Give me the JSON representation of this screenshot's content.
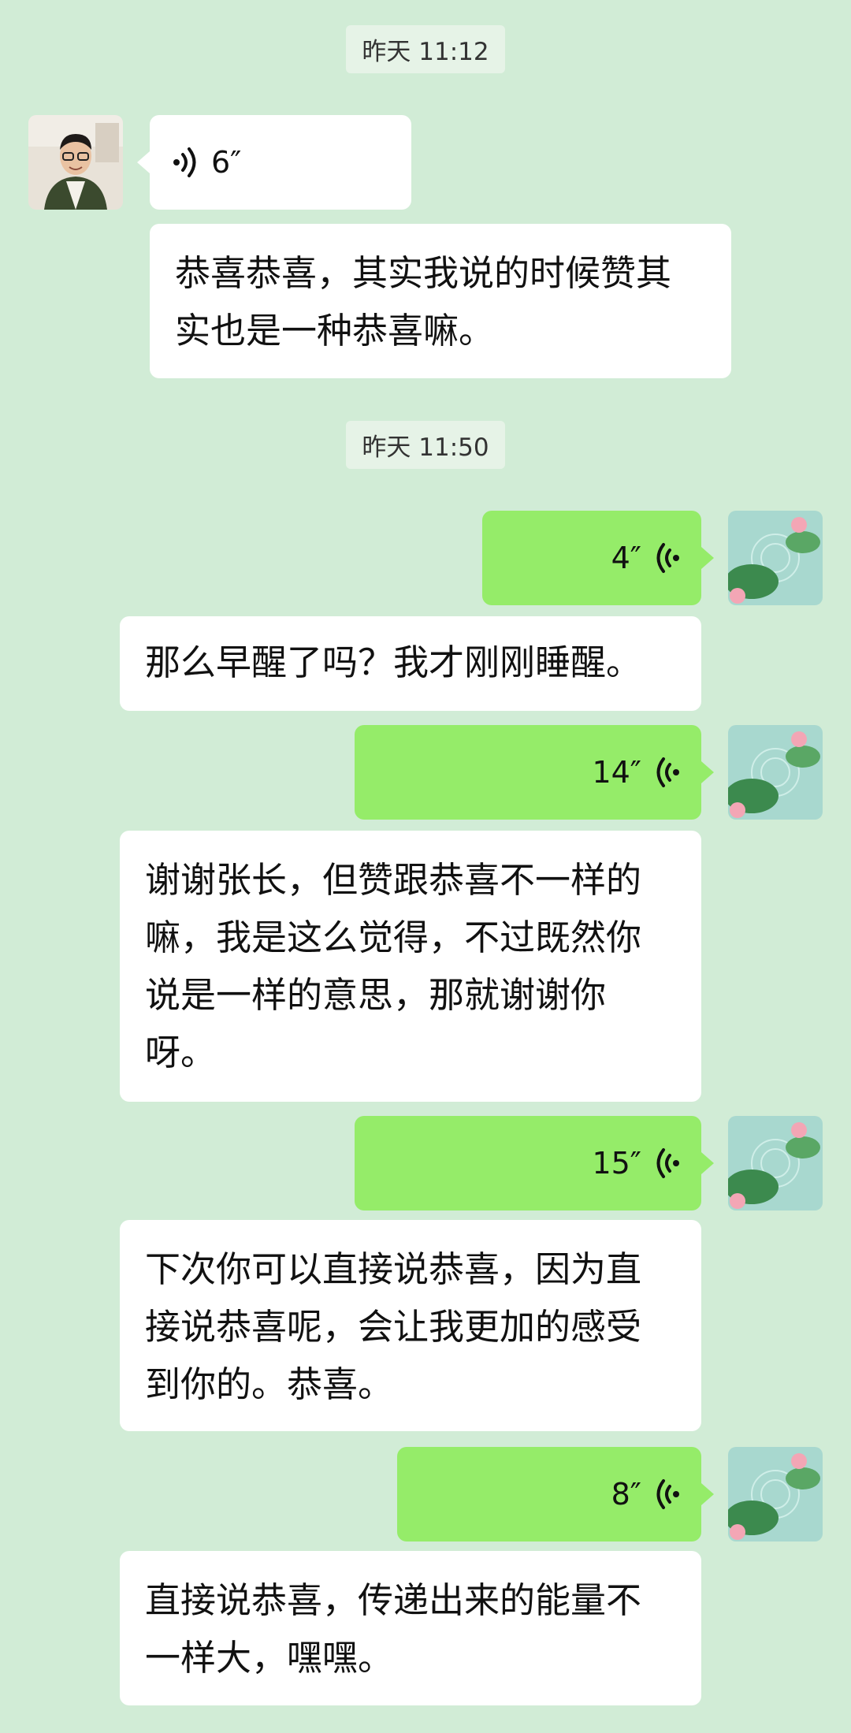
{
  "messages": [
    {
      "type": "timestamp",
      "text": "昨天 11:12"
    },
    {
      "type": "voice",
      "side": "left",
      "duration": "6″",
      "icon": "voice-wave-icon"
    },
    {
      "type": "text",
      "side": "left",
      "text": "恭喜恭喜，其实我说的时候赞其实也是一种恭喜嘛。"
    },
    {
      "type": "timestamp",
      "text": "昨天 11:50"
    },
    {
      "type": "voice",
      "side": "right",
      "duration": "4″",
      "icon": "voice-wave-icon"
    },
    {
      "type": "text",
      "side": "left",
      "text": "那么早醒了吗？我才刚刚睡醒。"
    },
    {
      "type": "voice",
      "side": "right",
      "duration": "14″",
      "icon": "voice-wave-icon"
    },
    {
      "type": "text",
      "side": "left",
      "text": "谢谢张长，但赞跟恭喜不一样的嘛，我是这么觉得，不过既然你说是一样的意思，那就谢谢你呀。"
    },
    {
      "type": "voice",
      "side": "right",
      "duration": "15″",
      "icon": "voice-wave-icon"
    },
    {
      "type": "text",
      "side": "left",
      "text": "下次你可以直接说恭喜，因为直接说恭喜呢，会让我更加的感受到你的。恭喜。"
    },
    {
      "type": "voice",
      "side": "right",
      "duration": "8″",
      "icon": "voice-wave-icon"
    },
    {
      "type": "text",
      "side": "left",
      "text": "直接说恭喜，传递出来的能量不一样大，嘿嘿。"
    }
  ],
  "colors": {
    "background": "#d1ecd6",
    "received_bubble": "#ffffff",
    "sent_bubble": "#95ec69"
  }
}
